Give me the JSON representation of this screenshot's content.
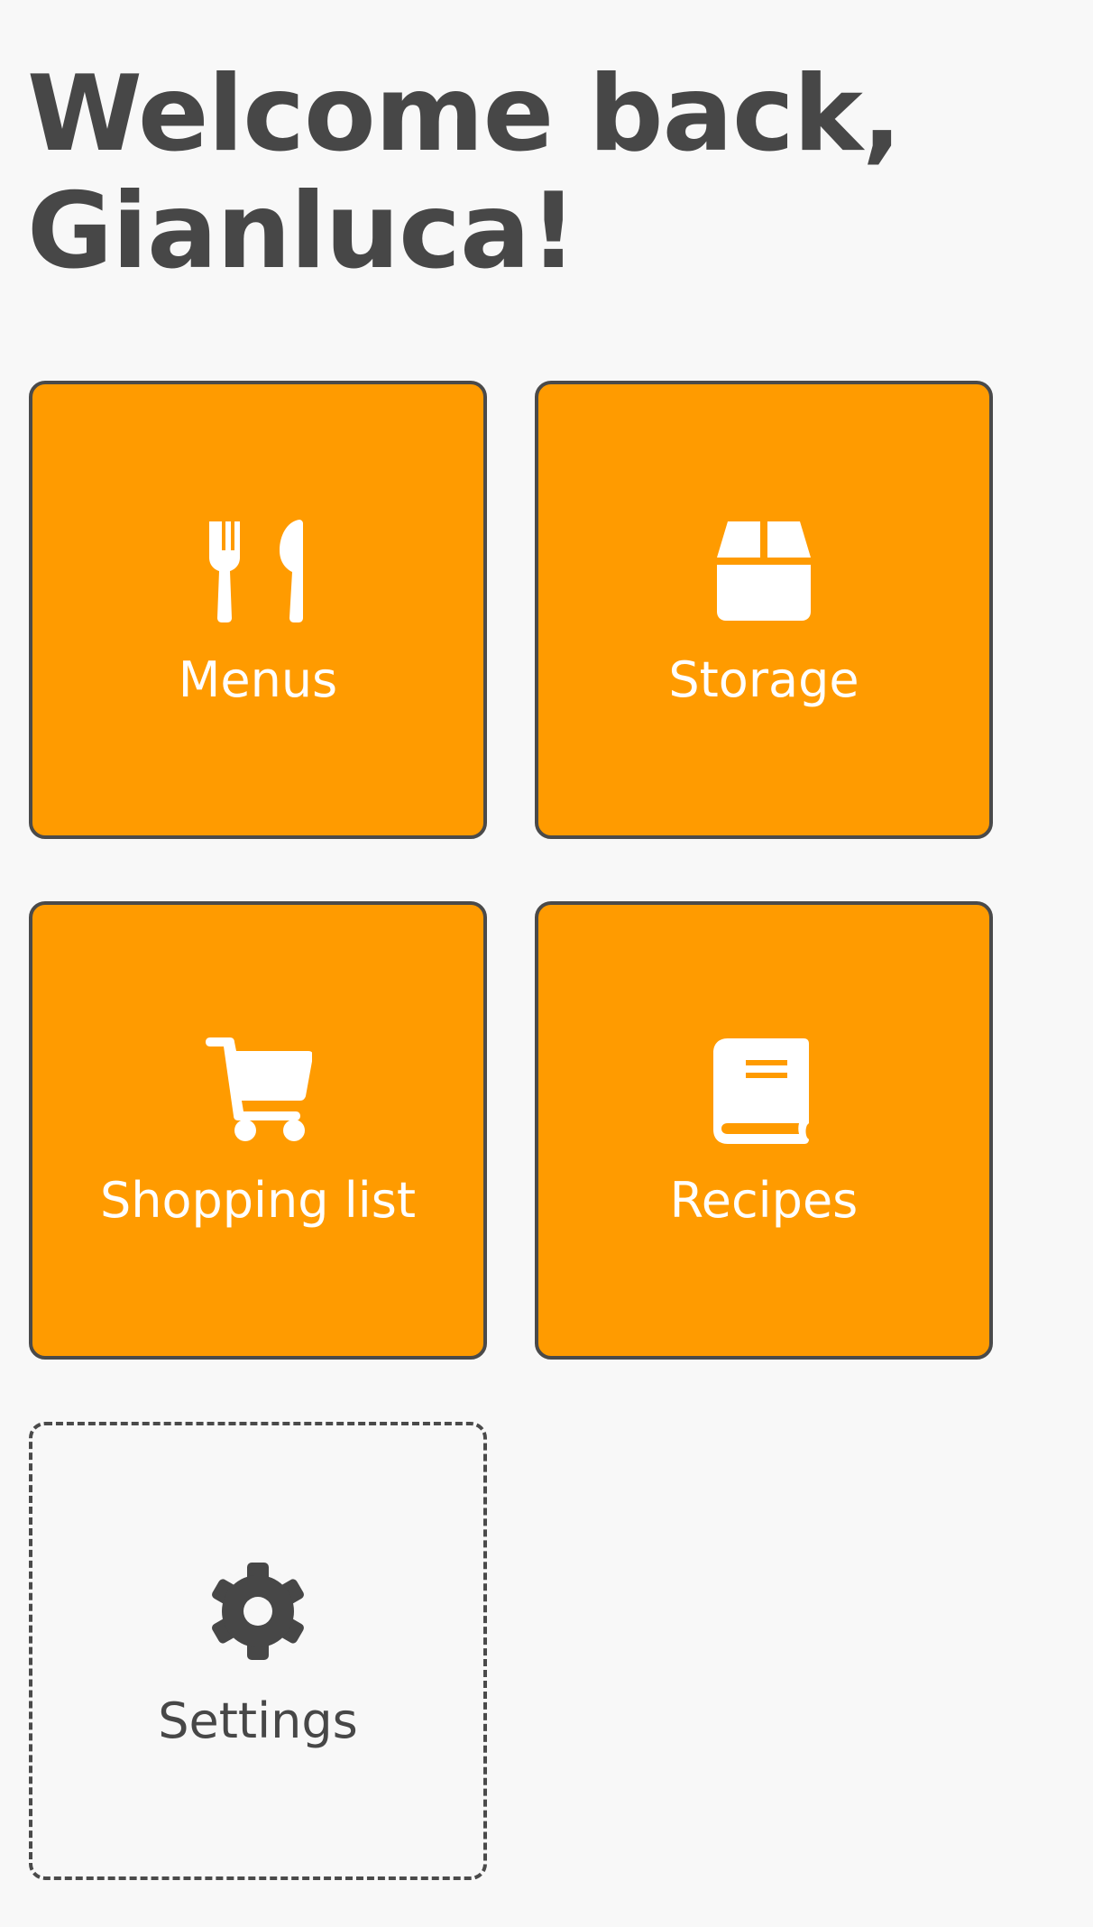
{
  "header": {
    "welcome_line1": "Welcome back,",
    "welcome_line2": "Gianluca!"
  },
  "tiles": [
    {
      "label": "Menus",
      "icon": "utensils-icon"
    },
    {
      "label": "Storage",
      "icon": "box-icon"
    },
    {
      "label": "Shopping list",
      "icon": "cart-icon"
    },
    {
      "label": "Recipes",
      "icon": "book-icon"
    },
    {
      "label": "Settings",
      "icon": "gear-icon"
    }
  ],
  "colors": {
    "accent": "#ff9b00",
    "text": "#474747",
    "border": "#4a4a4a",
    "background": "#f8f8f8",
    "tile_text": "#ffffff"
  }
}
